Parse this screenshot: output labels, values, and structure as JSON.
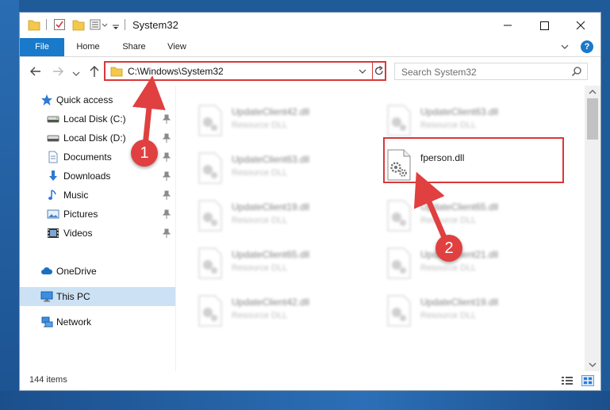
{
  "window": {
    "title": "System32"
  },
  "ribbon": {
    "tabs": [
      {
        "label": "File"
      },
      {
        "label": "Home"
      },
      {
        "label": "Share"
      },
      {
        "label": "View"
      }
    ],
    "help_label": "?"
  },
  "address": {
    "path": "C:\\Windows\\System32"
  },
  "search": {
    "placeholder": "Search System32"
  },
  "sidebar": {
    "items": [
      {
        "label": "Quick access",
        "icon": "star-icon"
      },
      {
        "label": "Local Disk (C:)",
        "icon": "drive-icon",
        "pinned": true
      },
      {
        "label": "Local Disk (D:)",
        "icon": "drive-icon",
        "pinned": true
      },
      {
        "label": "Documents",
        "icon": "documents-icon",
        "pinned": true
      },
      {
        "label": "Downloads",
        "icon": "download-icon",
        "pinned": true
      },
      {
        "label": "Music",
        "icon": "music-icon",
        "pinned": true
      },
      {
        "label": "Pictures",
        "icon": "pictures-icon",
        "pinned": true
      },
      {
        "label": "Videos",
        "icon": "videos-icon",
        "pinned": true
      },
      {
        "label": "OneDrive",
        "icon": "cloud-icon"
      },
      {
        "label": "This PC",
        "icon": "computer-icon",
        "selected": true
      },
      {
        "label": "Network",
        "icon": "network-icon"
      }
    ]
  },
  "files": [
    {
      "name": "UpdateClient42.dll",
      "type": "Resource DLL",
      "blurred": true
    },
    {
      "name": "UpdateClient63.dll",
      "type": "Resource DLL",
      "blurred": true
    },
    {
      "name": "UpdateClient63.dll",
      "type": "Resource DLL",
      "blurred": true
    },
    {
      "name": "fperson.dll",
      "type": "",
      "blurred": false
    },
    {
      "name": "UpdateClient19.dll",
      "type": "Resource DLL",
      "blurred": true
    },
    {
      "name": "UpdateClient65.dll",
      "type": "Resource DLL",
      "blurred": true
    },
    {
      "name": "UpdateClient65.dll",
      "type": "Resource DLL",
      "blurred": true
    },
    {
      "name": "UpdateClient21.dll",
      "type": "Resource DLL",
      "blurred": true
    },
    {
      "name": "UpdateClient42.dll",
      "type": "Resource DLL",
      "blurred": true
    },
    {
      "name": "UpdateClient19.dll",
      "type": "Resource DLL",
      "blurred": true
    }
  ],
  "status": {
    "item_count": "144 items"
  },
  "callouts": {
    "step1": "1",
    "step2": "2"
  },
  "colors": {
    "accent": "#1979ca",
    "annotation_red": "#d9383a",
    "selection": "#cce1f4"
  }
}
